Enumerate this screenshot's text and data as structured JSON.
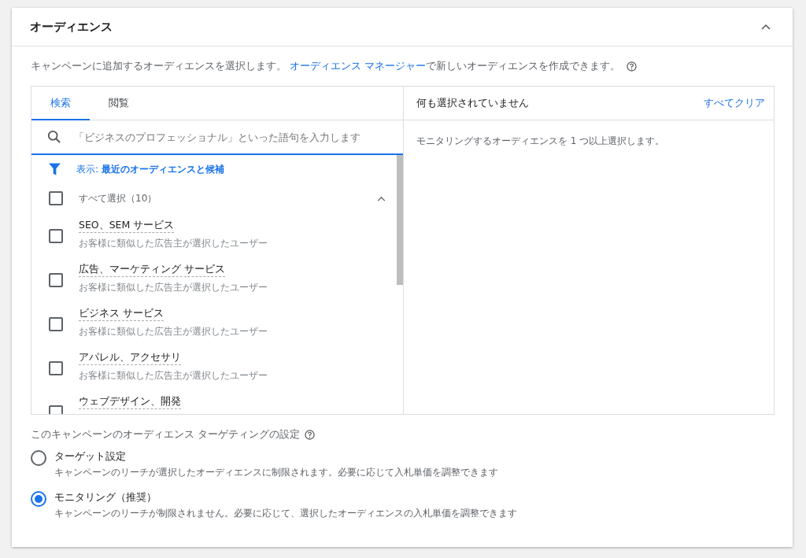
{
  "card": {
    "title": "オーディエンス",
    "expanded": true
  },
  "description": {
    "before": "キャンペーンに追加するオーディエンスを選択します。",
    "link": "オーディエンス マネージャー",
    "after": "で新しいオーディエンスを作成できます。"
  },
  "picker": {
    "tabs": [
      {
        "label": "検索",
        "selected": true
      },
      {
        "label": "閲覧",
        "selected": false
      }
    ],
    "search": {
      "placeholder": "「ビジネスのプロフェッショナル」といった語句を入力します"
    },
    "filter": "表示: **最近のオーディエンスと候補**",
    "select_all": {
      "label": "すべて選択（10）",
      "checked": false,
      "expanded": true
    },
    "items": [
      {
        "title": "SEO、SEM サービス",
        "subtitle": "お客様に類似した広告主が選択したユーザー",
        "checked": false
      },
      {
        "title": "広告、マーケティング サービス",
        "subtitle": "お客様に類似した広告主が選択したユーザー",
        "checked": false
      },
      {
        "title": "ビジネス サービス",
        "subtitle": "お客様に類似した広告主が選択したユーザー",
        "checked": false
      },
      {
        "title": "アパレル、アクセサリ",
        "subtitle": "お客様に類似した広告主が選択したユーザー",
        "checked": false
      },
      {
        "title": "ウェブデザイン、開発",
        "checked": false
      }
    ]
  },
  "selection": {
    "status": "何も選択されていません",
    "clear": "すべてクリア",
    "message": "モニタリングするオーディエンスを 1 つ以上選択します。"
  },
  "targeting": {
    "label": "このキャンペーンのオーディエンス ターゲティングの設定",
    "options": [
      {
        "title": "ターゲット設定",
        "description": "キャンペーンのリーチが選択したオーディエンスに制限されます。必要に応じて入札単価を調整できます",
        "selected": false
      },
      {
        "title": "モニタリング（推奨）",
        "description": "キャンペーンのリーチが制限されません。必要に応じて、選択したオーディエンスの入札単価を調整できます",
        "selected": true
      }
    ]
  }
}
